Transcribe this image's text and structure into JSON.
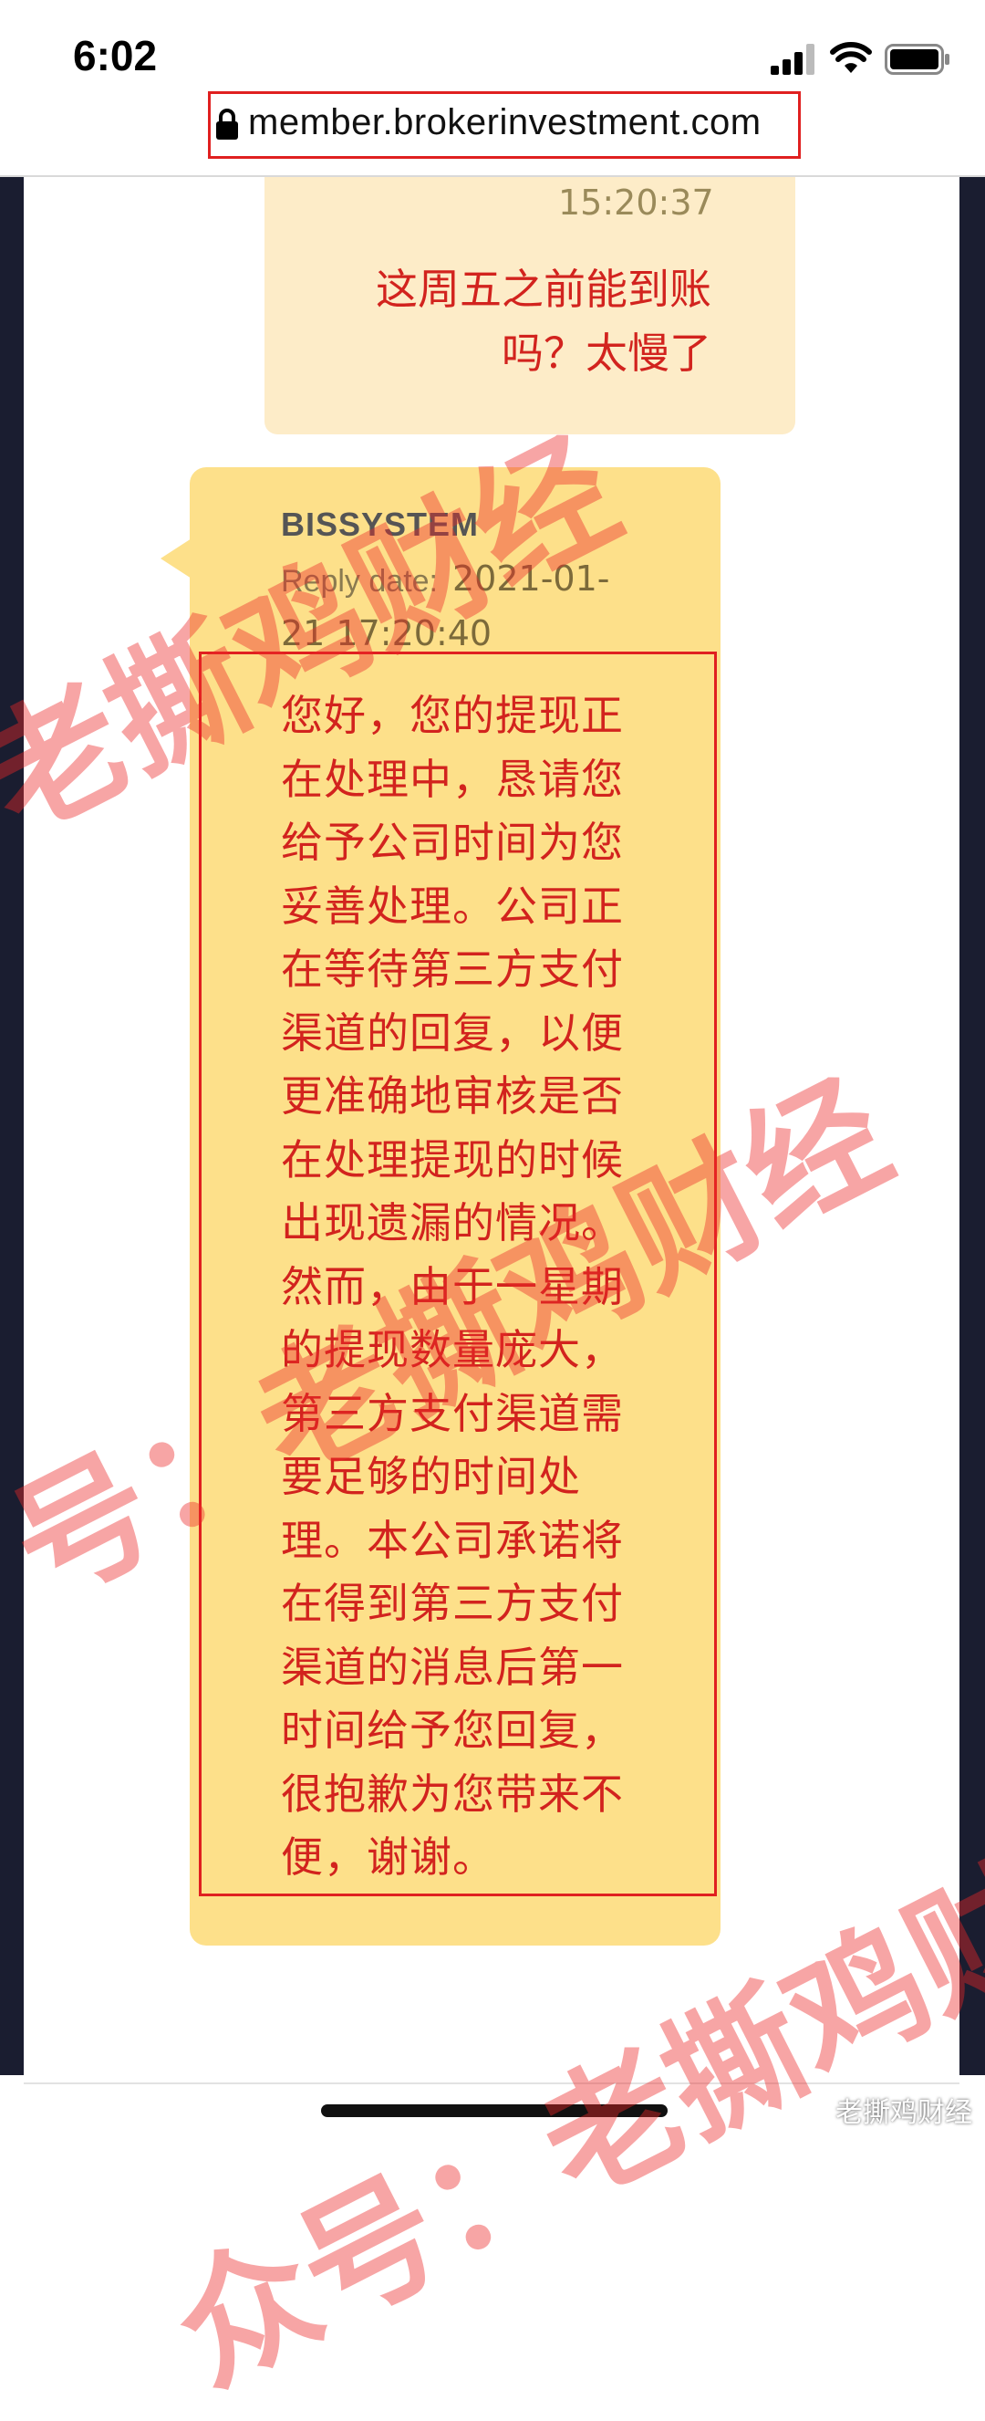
{
  "status_bar": {
    "time": "6:02"
  },
  "browser": {
    "url": "member.brokerinvestment.com"
  },
  "chat": {
    "user_message": {
      "time": "15:20:37",
      "text": "这周五之前能到账吗？太慢了"
    },
    "system_message": {
      "sender": "BISSYSTEM",
      "reply_label": "Reply date:",
      "reply_date_part1": "2021-01-",
      "reply_date_part2": "21 17:20:40",
      "text": "您好，您的提现正在处理中，恳请您给予公司时间为您妥善处理。公司正在等待第三方支付渠道的回复，以便更准确地审核是否在处理提现的时候出现遗漏的情况。然而，由于一星期的提现数量庞大，第三方支付渠道需要足够的时间处理。本公司承诺将在得到第三方支付渠道的消息后第一时间给予您回复，很抱歉为您带来不便，谢谢。"
    }
  },
  "watermark": {
    "line1": "老撕鸡财经",
    "line2": "号：老撕鸡财经",
    "line3": "众号：老撕鸡财",
    "brand": "老撕鸡财经"
  },
  "colors": {
    "message_text": "#d2231e",
    "system_bubble": "#fde08a",
    "user_bubble": "#fdecc8",
    "highlight_box": "#e02020"
  }
}
